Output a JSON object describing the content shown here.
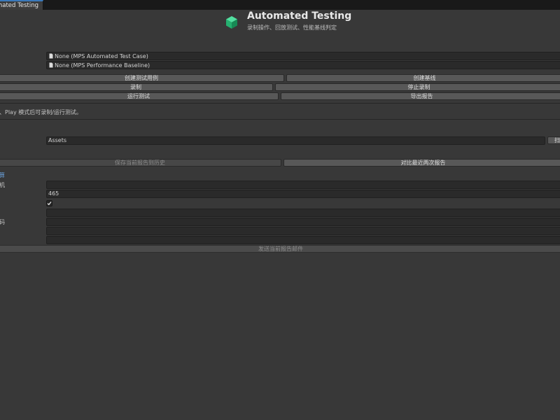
{
  "window": {
    "tab_title": "Automated Testing"
  },
  "header": {
    "title": "Automated Testing",
    "subtitle": "录制操作、回放测试、性能基线判定",
    "logo_icon": "green-cube-icon"
  },
  "asset_fields": {
    "test_case": "None (MPS Automated Test Case)",
    "baseline": "None (MPS Performance Baseline)"
  },
  "actions": {
    "create_test_case": "创建测试用例",
    "create_baseline": "创建基线",
    "record": "录制",
    "stop_record": "停止录制",
    "run_test": "运行测试",
    "export_report": "导出报告"
  },
  "hint": "、Play 模式后可录制/运行测试。",
  "folder": {
    "path": "Assets",
    "scan_label": "扫"
  },
  "history": {
    "save_label": "保存当前报告到历史",
    "compare_label": "对比最近两次报告"
  },
  "email": {
    "section_label": "算",
    "host_label": "机",
    "port": "465",
    "ssl_checked": true,
    "password_label": "码",
    "send_label": "发送当前报告邮件"
  },
  "colors": {
    "accent": "#3a79bb",
    "link": "#6aa2dc",
    "cube": "#27c27f"
  }
}
